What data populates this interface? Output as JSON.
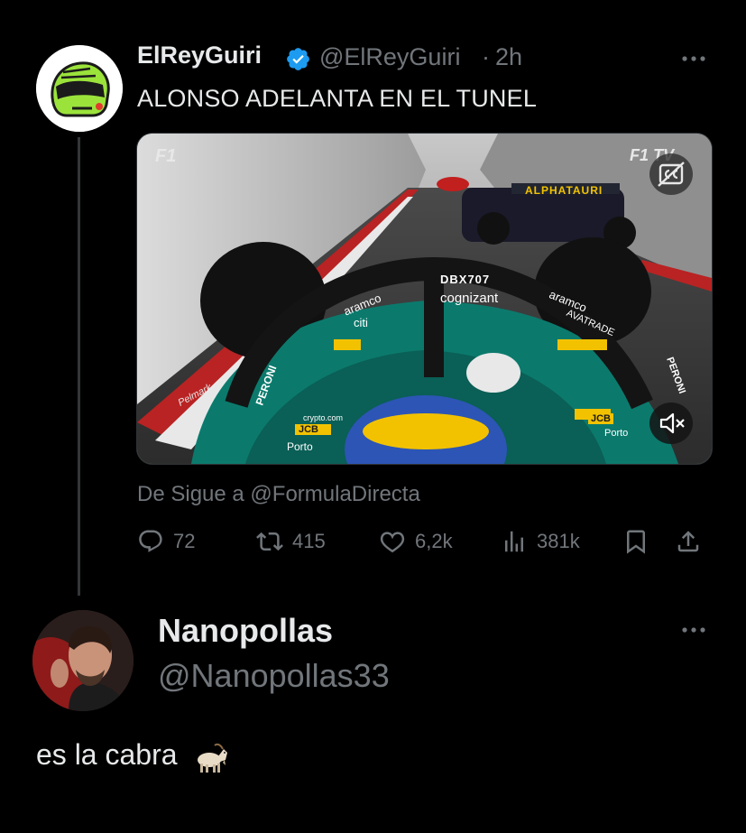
{
  "tweet": {
    "display_name": "ElReyGuiri",
    "handle": "@ElReyGuiri",
    "separator": "·",
    "time": "2h",
    "text": "ALONSO ADELANTA EN EL TUNEL",
    "verified": true,
    "avatar_icon": "helmet-avatar",
    "media": {
      "type": "video",
      "overlay_text": {
        "f1_logo": "F1",
        "f1tv_logo": "F1 TV",
        "car_number_plate": "DBX707",
        "sponsor_cognizant": "cognizant",
        "sponsor_aramco_left": "aramco",
        "sponsor_aramco_right": "aramco",
        "sponsor_citi": "citi",
        "sponsor_avatrade": "AVATRADE",
        "sponsor_peroni_left": "PERONI",
        "sponsor_peroni_right": "PERONI",
        "sponsor_jcb_left": "JCB",
        "sponsor_jcb_right": "JCB",
        "sponsor_porto_left": "Porto",
        "sponsor_porto_right": "Porto",
        "sponsor_crypto": "crypto.com",
        "sponsor_alphatauri": "ALPHATAURI",
        "sponsor_pelmark": "Pelmark"
      },
      "controls": {
        "captions_icon": "cc-icon",
        "mute_icon": "volume-muted-icon"
      }
    },
    "attribution": "De Sigue a @FormulaDirecta",
    "stats": {
      "replies": "72",
      "retweets": "415",
      "likes": "6,2k",
      "views": "381k"
    }
  },
  "reply": {
    "display_name": "Nanopollas",
    "handle": "@Nanopollas33",
    "text": "es la cabra",
    "emoji": "goat-emoji"
  },
  "colors": {
    "background": "#000000",
    "primary_text": "#e7e9ea",
    "secondary_text": "#71767b",
    "verified_blue": "#1d9bf0",
    "divider": "#333639",
    "aston_green": "#0b7a6d"
  }
}
